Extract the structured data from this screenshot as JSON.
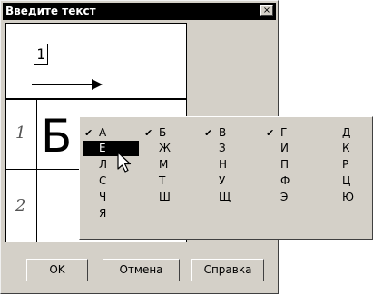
{
  "dialog": {
    "title": "Введите текст",
    "close_glyph": "×"
  },
  "preview": {
    "number": "1",
    "char": "Б"
  },
  "rows": [
    {
      "num": "1"
    },
    {
      "num": "2"
    }
  ],
  "popup": {
    "check_glyph": "✔",
    "items": [
      {
        "char": "А",
        "checked": true
      },
      {
        "char": "Б",
        "checked": true
      },
      {
        "char": "В",
        "checked": true
      },
      {
        "char": "Г",
        "checked": true
      },
      {
        "char": "Д",
        "checked": false
      },
      {
        "char": "Е",
        "checked": false,
        "selected": true
      },
      {
        "char": "Ж",
        "checked": false
      },
      {
        "char": "З",
        "checked": false
      },
      {
        "char": "И",
        "checked": false
      },
      {
        "char": "К",
        "checked": false
      },
      {
        "char": "Л",
        "checked": false
      },
      {
        "char": "М",
        "checked": false
      },
      {
        "char": "Н",
        "checked": false
      },
      {
        "char": "П",
        "checked": false
      },
      {
        "char": "Р",
        "checked": false
      },
      {
        "char": "С",
        "checked": false
      },
      {
        "char": "Т",
        "checked": false
      },
      {
        "char": "У",
        "checked": false
      },
      {
        "char": "Ф",
        "checked": false
      },
      {
        "char": "Ц",
        "checked": false
      },
      {
        "char": "Ч",
        "checked": false
      },
      {
        "char": "Ш",
        "checked": false
      },
      {
        "char": "Щ",
        "checked": false
      },
      {
        "char": "Э",
        "checked": false
      },
      {
        "char": "Ю",
        "checked": false
      },
      {
        "char": "Я",
        "checked": false
      }
    ]
  },
  "buttons": {
    "ok": "OK",
    "cancel": "Отмена",
    "help": "Справка"
  }
}
